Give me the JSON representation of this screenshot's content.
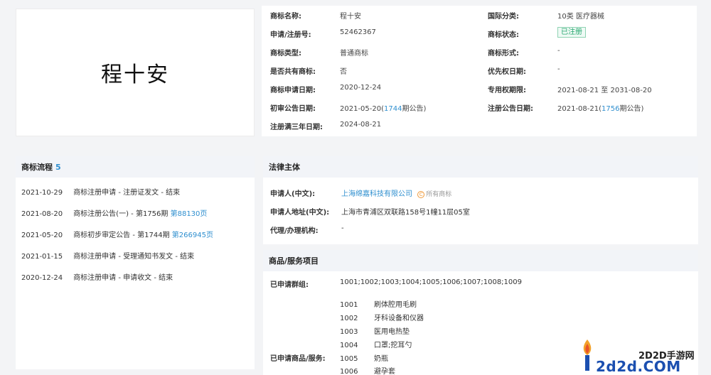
{
  "logo": {
    "text": "程十安"
  },
  "info": {
    "name_label": "商标名称:",
    "name_value": "程十安",
    "regno_label": "申请/注册号:",
    "regno_value": "52462367",
    "type_label": "商标类型:",
    "type_value": "普通商标",
    "shared_label": "是否共有商标:",
    "shared_value": "否",
    "apply_date_label": "商标申请日期:",
    "apply_date_value": "2020-12-24",
    "prelim_label": "初审公告日期:",
    "prelim_date": "2021-05-20",
    "prelim_issue": "1744",
    "prelim_suffix": "期公告)",
    "expire_label": "注册满三年日期:",
    "expire_value": "2024-08-21",
    "intl_label": "国际分类:",
    "intl_value": "10类 医疗器械",
    "status_label": "商标状态:",
    "status_value": "已注册",
    "form_label": "商标形式:",
    "form_value": "-",
    "priority_label": "优先权日期:",
    "priority_value": "-",
    "exclusive_label": "专用权期限:",
    "exclusive_value": "2021-08-21 至 2031-08-20",
    "reg_notice_label": "注册公告日期:",
    "reg_notice_date": "2021-08-21",
    "reg_notice_issue": "1756",
    "reg_notice_suffix": "期公告)"
  },
  "flow": {
    "title": "商标流程",
    "count": "5",
    "items": [
      {
        "date": "2021-10-29",
        "text": "商标注册申请 - 注册证发文 - 结束",
        "link": ""
      },
      {
        "date": "2021-08-20",
        "text": "商标注册公告(一) - 第1756期",
        "link": "第88130页"
      },
      {
        "date": "2021-05-20",
        "text": "商标初步审定公告 - 第1744期",
        "link": "第266945页"
      },
      {
        "date": "2021-01-15",
        "text": "商标注册申请 - 受理通知书发文 - 结束",
        "link": ""
      },
      {
        "date": "2020-12-24",
        "text": "商标注册申请 - 申请收文 - 结束",
        "link": ""
      }
    ]
  },
  "legal": {
    "title": "法律主体",
    "applicant_label": "申请人(中文):",
    "applicant_value": "上海绵嘉科技有限公司",
    "own_badge": "所有商标",
    "own_icon": "C",
    "address_label": "申请人地址(中文):",
    "address_value": "上海市青浦区双联路158号1幢11层05室",
    "agent_label": "代理/办理机构:",
    "agent_value": "-"
  },
  "goods": {
    "title": "商品/服务项目",
    "groups_label": "已申请群组:",
    "groups_value": "1001;1002;1003;1004;1005;1006;1007;1008;1009",
    "items_label": "已申请商品/服务:",
    "items": [
      {
        "code": "1001",
        "name": "刷体腔用毛刷"
      },
      {
        "code": "1002",
        "name": "牙科设备和仪器"
      },
      {
        "code": "1003",
        "name": "医用电热垫"
      },
      {
        "code": "1004",
        "name": "口罩;挖耳勺"
      },
      {
        "code": "1005",
        "name": "奶瓶"
      },
      {
        "code": "1006",
        "name": "避孕套"
      }
    ]
  },
  "watermark": {
    "sub": "2D2D手游网",
    "main": "2d2d.COM"
  }
}
